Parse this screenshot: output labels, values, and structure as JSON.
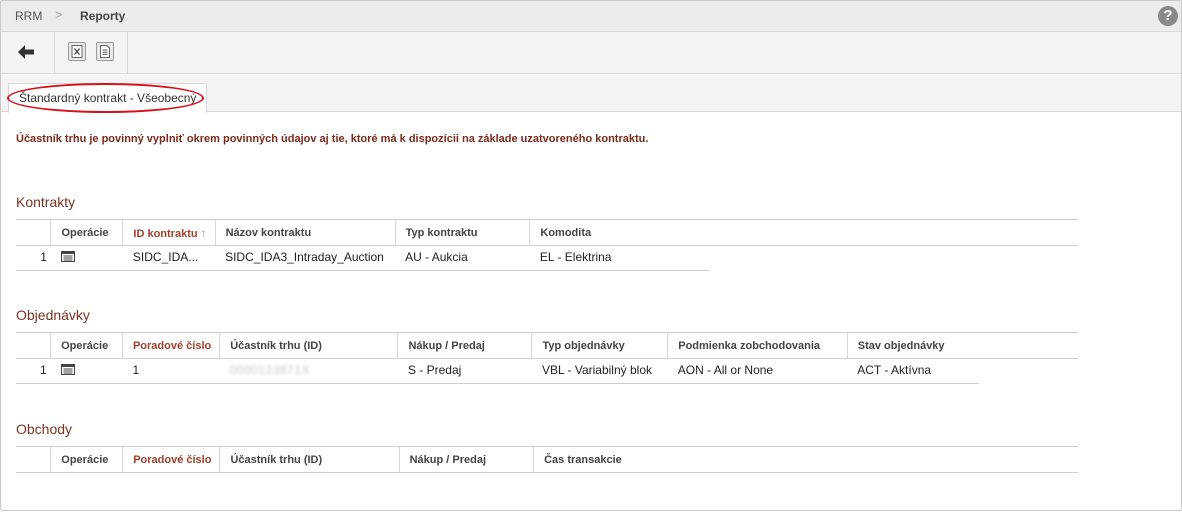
{
  "breadcrumb": {
    "root": "RRM",
    "separator": ">",
    "current": "Reporty"
  },
  "help_icon": "?",
  "toolbar": {
    "back_icon": "arrow-left-icon",
    "excel_icon": "excel-export-icon",
    "doc_icon": "document-export-icon"
  },
  "tab": {
    "label": "Štandardný kontrakt - Všeobecný"
  },
  "notice": "Účastník trhu je povinný vyplniť okrem povinných údajov aj tie, ktoré má k dispozícii na základe uzatvoreného kontraktu.",
  "colors": {
    "accent": "#7c3322",
    "highlight_ring": "#d8121c",
    "notice": "#7c2a1a"
  },
  "kontrakty": {
    "title": "Kontrakty",
    "columns": [
      "Operácie",
      "ID kontraktu",
      "Názov kontraktu",
      "Typ kontraktu",
      "Komodita"
    ],
    "sort_indicator": "↑",
    "rows": [
      {
        "num": "1",
        "id": "SIDC_IDA...",
        "name": "SIDC_IDA3_Intraday_Auction",
        "type": "AU - Aukcia",
        "commodity": "EL - Elektrina"
      }
    ]
  },
  "objednavky": {
    "title": "Objednávky",
    "columns": [
      "Operácie",
      "Poradové číslo",
      "Účastník trhu (ID)",
      "Nákup / Predaj",
      "Typ objednávky",
      "Podmienka zobchodovania",
      "Stav objednávky"
    ],
    "rows": [
      {
        "num": "1",
        "order": "1",
        "participant": "0000123871X",
        "side": "S - Predaj",
        "order_type": "VBL - Variabilný blok",
        "condition": "AON - All or None",
        "status": "ACT - Aktívna"
      }
    ]
  },
  "obchody": {
    "title": "Obchody",
    "columns": [
      "Operácie",
      "Poradové číslo",
      "Účastník trhu (ID)",
      "Nákup / Predaj",
      "Čas transakcie"
    ]
  }
}
